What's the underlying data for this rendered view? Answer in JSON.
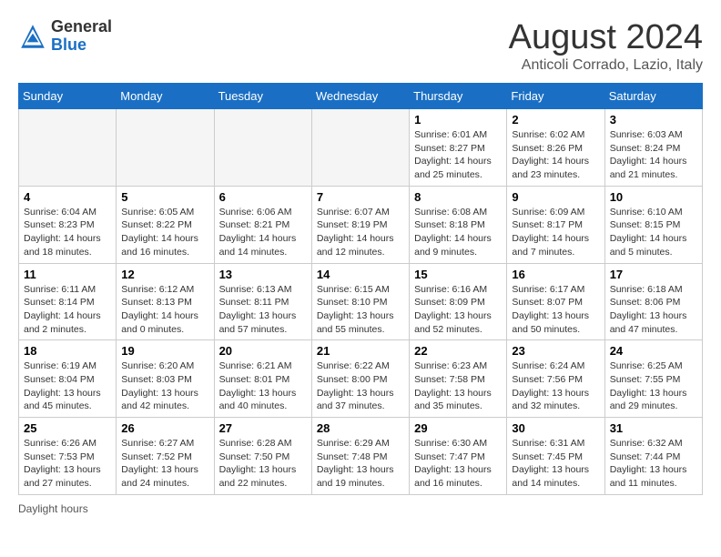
{
  "header": {
    "logo_general": "General",
    "logo_blue": "Blue",
    "month_title": "August 2024",
    "location": "Anticoli Corrado, Lazio, Italy"
  },
  "days_of_week": [
    "Sunday",
    "Monday",
    "Tuesday",
    "Wednesday",
    "Thursday",
    "Friday",
    "Saturday"
  ],
  "weeks": [
    [
      {
        "day": "",
        "info": ""
      },
      {
        "day": "",
        "info": ""
      },
      {
        "day": "",
        "info": ""
      },
      {
        "day": "",
        "info": ""
      },
      {
        "day": "1",
        "info": "Sunrise: 6:01 AM\nSunset: 8:27 PM\nDaylight: 14 hours and 25 minutes."
      },
      {
        "day": "2",
        "info": "Sunrise: 6:02 AM\nSunset: 8:26 PM\nDaylight: 14 hours and 23 minutes."
      },
      {
        "day": "3",
        "info": "Sunrise: 6:03 AM\nSunset: 8:24 PM\nDaylight: 14 hours and 21 minutes."
      }
    ],
    [
      {
        "day": "4",
        "info": "Sunrise: 6:04 AM\nSunset: 8:23 PM\nDaylight: 14 hours and 18 minutes."
      },
      {
        "day": "5",
        "info": "Sunrise: 6:05 AM\nSunset: 8:22 PM\nDaylight: 14 hours and 16 minutes."
      },
      {
        "day": "6",
        "info": "Sunrise: 6:06 AM\nSunset: 8:21 PM\nDaylight: 14 hours and 14 minutes."
      },
      {
        "day": "7",
        "info": "Sunrise: 6:07 AM\nSunset: 8:19 PM\nDaylight: 14 hours and 12 minutes."
      },
      {
        "day": "8",
        "info": "Sunrise: 6:08 AM\nSunset: 8:18 PM\nDaylight: 14 hours and 9 minutes."
      },
      {
        "day": "9",
        "info": "Sunrise: 6:09 AM\nSunset: 8:17 PM\nDaylight: 14 hours and 7 minutes."
      },
      {
        "day": "10",
        "info": "Sunrise: 6:10 AM\nSunset: 8:15 PM\nDaylight: 14 hours and 5 minutes."
      }
    ],
    [
      {
        "day": "11",
        "info": "Sunrise: 6:11 AM\nSunset: 8:14 PM\nDaylight: 14 hours and 2 minutes."
      },
      {
        "day": "12",
        "info": "Sunrise: 6:12 AM\nSunset: 8:13 PM\nDaylight: 14 hours and 0 minutes."
      },
      {
        "day": "13",
        "info": "Sunrise: 6:13 AM\nSunset: 8:11 PM\nDaylight: 13 hours and 57 minutes."
      },
      {
        "day": "14",
        "info": "Sunrise: 6:15 AM\nSunset: 8:10 PM\nDaylight: 13 hours and 55 minutes."
      },
      {
        "day": "15",
        "info": "Sunrise: 6:16 AM\nSunset: 8:09 PM\nDaylight: 13 hours and 52 minutes."
      },
      {
        "day": "16",
        "info": "Sunrise: 6:17 AM\nSunset: 8:07 PM\nDaylight: 13 hours and 50 minutes."
      },
      {
        "day": "17",
        "info": "Sunrise: 6:18 AM\nSunset: 8:06 PM\nDaylight: 13 hours and 47 minutes."
      }
    ],
    [
      {
        "day": "18",
        "info": "Sunrise: 6:19 AM\nSunset: 8:04 PM\nDaylight: 13 hours and 45 minutes."
      },
      {
        "day": "19",
        "info": "Sunrise: 6:20 AM\nSunset: 8:03 PM\nDaylight: 13 hours and 42 minutes."
      },
      {
        "day": "20",
        "info": "Sunrise: 6:21 AM\nSunset: 8:01 PM\nDaylight: 13 hours and 40 minutes."
      },
      {
        "day": "21",
        "info": "Sunrise: 6:22 AM\nSunset: 8:00 PM\nDaylight: 13 hours and 37 minutes."
      },
      {
        "day": "22",
        "info": "Sunrise: 6:23 AM\nSunset: 7:58 PM\nDaylight: 13 hours and 35 minutes."
      },
      {
        "day": "23",
        "info": "Sunrise: 6:24 AM\nSunset: 7:56 PM\nDaylight: 13 hours and 32 minutes."
      },
      {
        "day": "24",
        "info": "Sunrise: 6:25 AM\nSunset: 7:55 PM\nDaylight: 13 hours and 29 minutes."
      }
    ],
    [
      {
        "day": "25",
        "info": "Sunrise: 6:26 AM\nSunset: 7:53 PM\nDaylight: 13 hours and 27 minutes."
      },
      {
        "day": "26",
        "info": "Sunrise: 6:27 AM\nSunset: 7:52 PM\nDaylight: 13 hours and 24 minutes."
      },
      {
        "day": "27",
        "info": "Sunrise: 6:28 AM\nSunset: 7:50 PM\nDaylight: 13 hours and 22 minutes."
      },
      {
        "day": "28",
        "info": "Sunrise: 6:29 AM\nSunset: 7:48 PM\nDaylight: 13 hours and 19 minutes."
      },
      {
        "day": "29",
        "info": "Sunrise: 6:30 AM\nSunset: 7:47 PM\nDaylight: 13 hours and 16 minutes."
      },
      {
        "day": "30",
        "info": "Sunrise: 6:31 AM\nSunset: 7:45 PM\nDaylight: 13 hours and 14 minutes."
      },
      {
        "day": "31",
        "info": "Sunrise: 6:32 AM\nSunset: 7:44 PM\nDaylight: 13 hours and 11 minutes."
      }
    ]
  ],
  "footer": {
    "note": "Daylight hours"
  }
}
